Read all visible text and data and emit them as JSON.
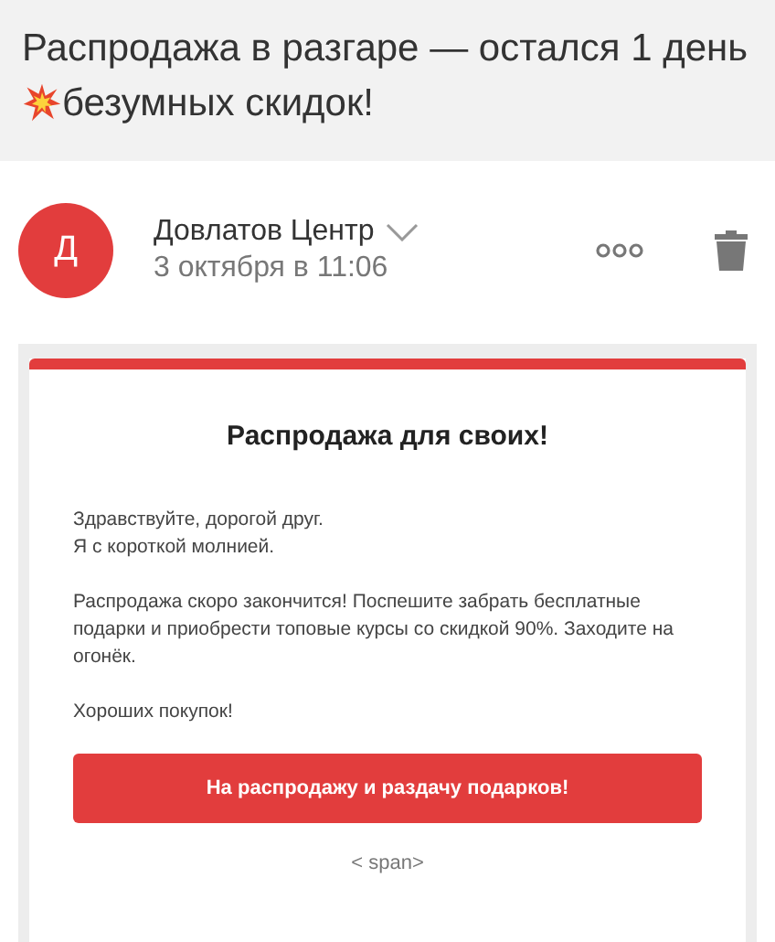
{
  "subject": {
    "before_icon": "Распродажа в разгаре — остался 1 день",
    "after_icon": "безумных скидок!"
  },
  "sender": {
    "avatar_letter": "Д",
    "name": "Довлатов Центр",
    "date": "3 октября в 11:06"
  },
  "letter": {
    "heading": "Распродажа для своих!",
    "paragraphs": [
      [
        "Здравствуйте, дорогой друг.",
        "Я с короткой молнией."
      ],
      [
        "Распродажа скоро закончится! Поспешите забрать бесплатные подарки и приобрести топовые курсы со скидкой 90%. Заходите на огонёк."
      ],
      [
        "Хороших покупок!"
      ]
    ],
    "button": "На распродажу и раздачу подарков!",
    "footer": "< span>"
  }
}
